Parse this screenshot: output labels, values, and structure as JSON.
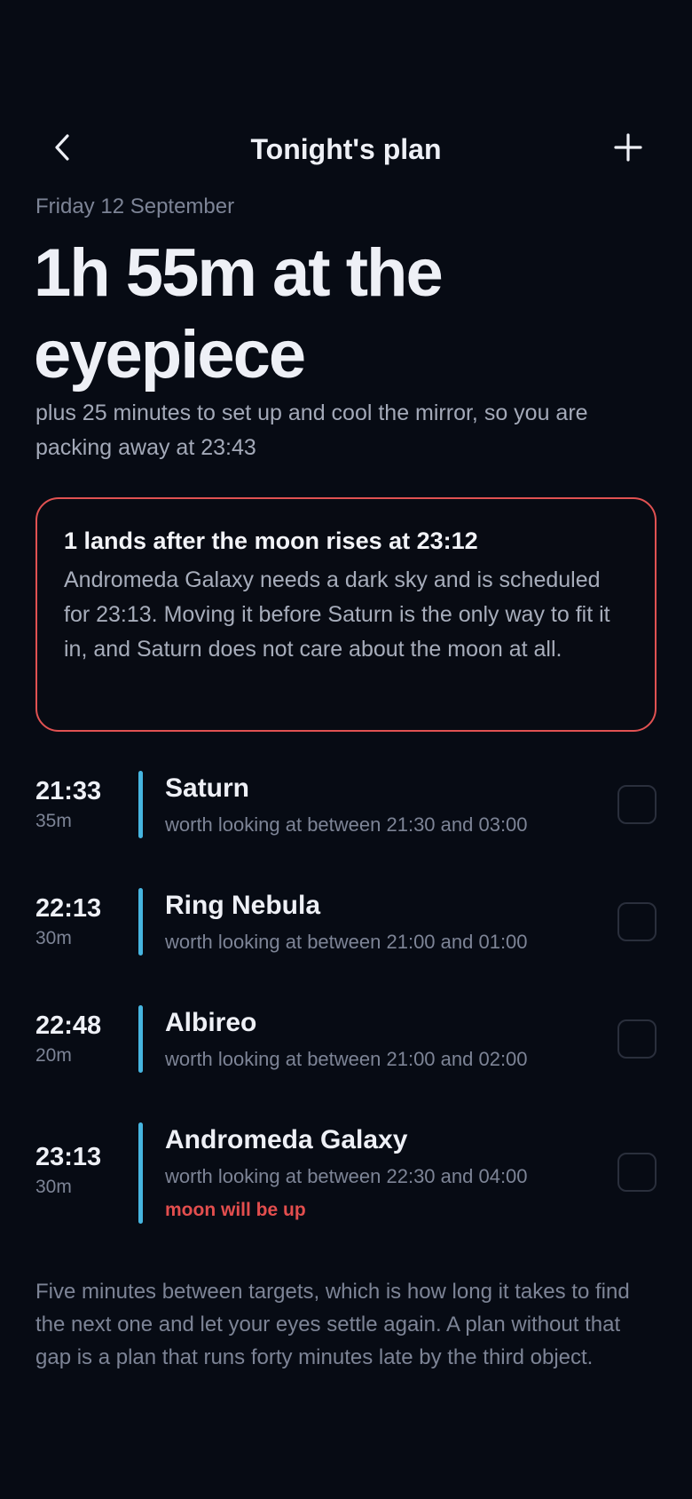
{
  "header": {
    "title": "Tonight's plan",
    "back_icon": "chevron-left-icon",
    "add_icon": "plus-icon"
  },
  "summary": {
    "date": "Friday 12 September",
    "headline": "1h 55m at the eyepiece",
    "subline": "plus 25 minutes to set up and cool the mirror, so you are packing away at 23:43"
  },
  "warning": {
    "title": "1 lands after the moon rises at 23:12",
    "body": "Andromeda Galaxy needs a dark sky and is scheduled for 23:13. Moving it before Saturn is the only way to fit it in, and Saturn does not care about the moon at all."
  },
  "schedule": [
    {
      "time": "21:33",
      "duration": "35m",
      "name": "Saturn",
      "window": "worth looking at between 21:30 and 03:00",
      "note": ""
    },
    {
      "time": "22:13",
      "duration": "30m",
      "name": "Ring Nebula",
      "window": "worth looking at between 21:00 and 01:00",
      "note": ""
    },
    {
      "time": "22:48",
      "duration": "20m",
      "name": "Albireo",
      "window": "worth looking at between 21:00 and 02:00",
      "note": ""
    },
    {
      "time": "23:13",
      "duration": "30m",
      "name": "Andromeda Galaxy",
      "window": "worth looking at between 22:30 and 04:00",
      "note": "moon will be up"
    }
  ],
  "footnote": "Five minutes between targets, which is how long it takes to find the next one and let your eyes settle again. A plan without that gap is a plan that runs forty minutes late by the third object.",
  "colors": {
    "background": "#070b14",
    "accent_bar": "#46b5e0",
    "warning": "#e15252"
  }
}
